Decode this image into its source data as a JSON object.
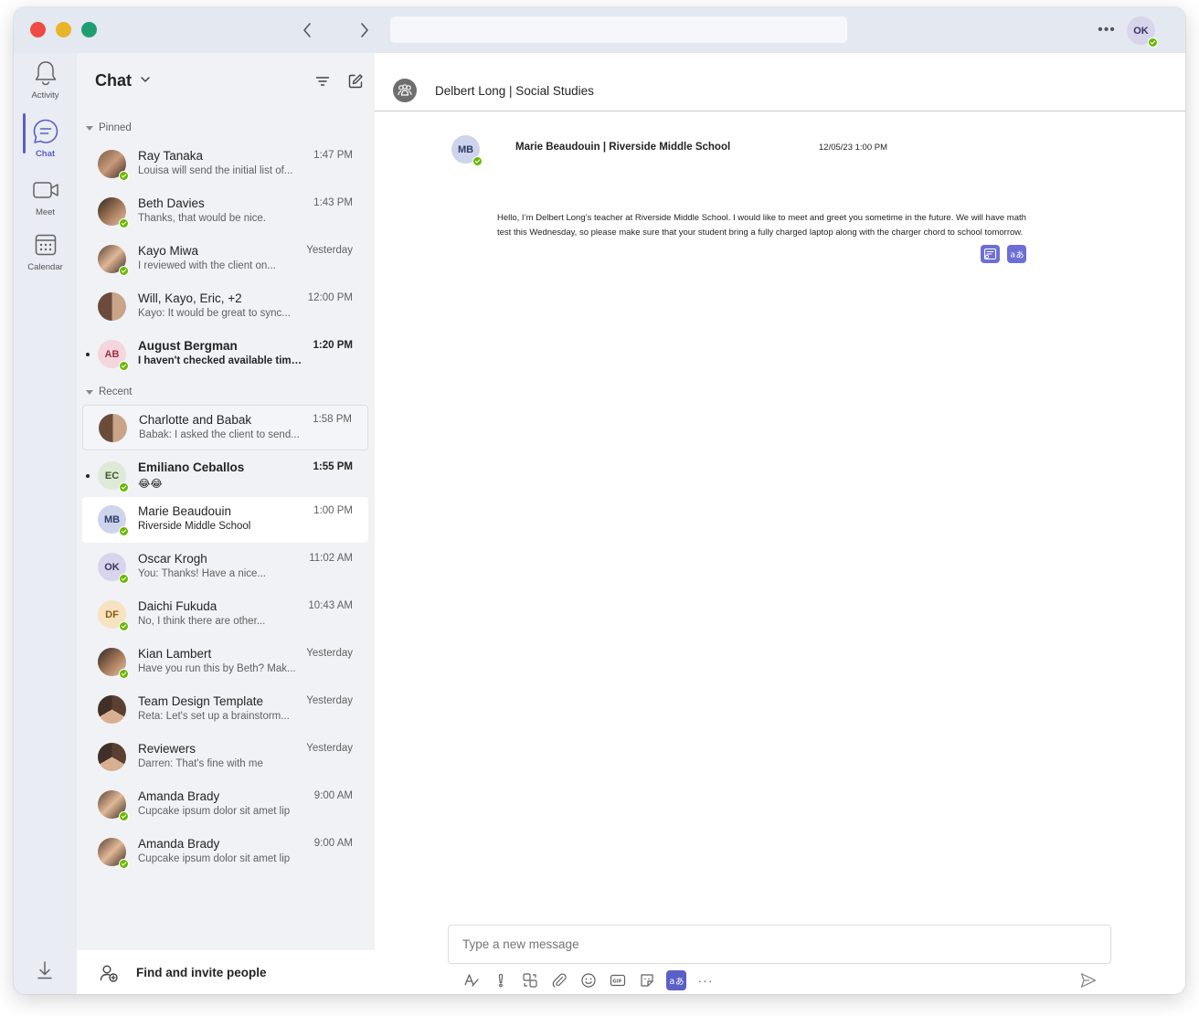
{
  "app": {
    "me_initials": "OK",
    "more_label": "•••"
  },
  "rail": {
    "items": [
      {
        "label": "Activity",
        "icon": "bell-icon"
      },
      {
        "label": "Chat",
        "icon": "chat-icon"
      },
      {
        "label": "Meet",
        "icon": "video-icon"
      },
      {
        "label": "Calendar",
        "icon": "calendar-icon"
      }
    ],
    "active": "Chat"
  },
  "list": {
    "title": "Chat",
    "sections": {
      "pinned": "Pinned",
      "recent": "Recent"
    },
    "pinned": [
      {
        "name": "Ray Tanaka",
        "preview": "Louisa will send the initial list of...",
        "time": "1:47 PM"
      },
      {
        "name": "Beth Davies",
        "preview": "Thanks, that would be nice.",
        "time": "1:43 PM"
      },
      {
        "name": "Kayo Miwa",
        "preview": "I reviewed with the client on...",
        "time": "Yesterday"
      },
      {
        "name": "Will, Kayo, Eric, +2",
        "preview": "Kayo: It would be great to sync...",
        "time": "12:00 PM"
      },
      {
        "name": "August Bergman",
        "initials": "AB",
        "preview": "I haven't checked available time...",
        "time": "1:20 PM",
        "unread": true
      }
    ],
    "recent": [
      {
        "name": "Charlotte and Babak",
        "preview": "Babak: I asked the client to send...",
        "time": "1:58 PM"
      },
      {
        "name": "Emiliano Ceballos",
        "initials": "EC",
        "preview": "😂😂",
        "time": "1:55 PM",
        "unread": true
      },
      {
        "name": "Marie Beaudouin",
        "initials": "MB",
        "preview": "Riverside Middle School",
        "time": "1:00 PM",
        "selected": true
      },
      {
        "name": "Oscar Krogh",
        "initials": "OK",
        "preview": "You: Thanks! Have a nice...",
        "time": "11:02 AM"
      },
      {
        "name": "Daichi Fukuda",
        "initials": "DF",
        "preview": "No, I think there are other...",
        "time": "10:43 AM"
      },
      {
        "name": "Kian Lambert",
        "preview": "Have you run this by Beth? Mak...",
        "time": "Yesterday"
      },
      {
        "name": "Team Design Template",
        "preview": "Reta: Let's set up a brainstorm...",
        "time": "Yesterday"
      },
      {
        "name": "Reviewers",
        "preview": "Darren: That's fine with me",
        "time": "Yesterday"
      },
      {
        "name": "Amanda Brady",
        "preview": "Cupcake ipsum dolor sit amet lip",
        "time": "9:00 AM"
      },
      {
        "name": "Amanda Brady",
        "preview": "Cupcake ipsum dolor sit amet lip",
        "time": "9:00 AM"
      }
    ],
    "footer_label": "Find and invite people"
  },
  "conversation": {
    "title": "Delbert Long | Social Studies",
    "message": {
      "sender_initials": "MB",
      "sender": "Marie Beaudouin | Riverside Middle School",
      "timestamp": "12/05/23 1:00 PM",
      "body": "Hello, I’m Delbert Long’s teacher at Riverside Middle School. I would like to meet and greet you sometime in the future. We will have math test this Wednesday, so please make sure that your student bring a fully charged laptop along with the charger chord to school tomorrow."
    },
    "compose_placeholder": "Type a new message",
    "toolbar_more": "···"
  },
  "colors": {
    "accent": "#5b5fc7",
    "presence": "#6bb700",
    "rail_bg": "#e9ecf2",
    "list_bg": "#f0f2f5"
  }
}
